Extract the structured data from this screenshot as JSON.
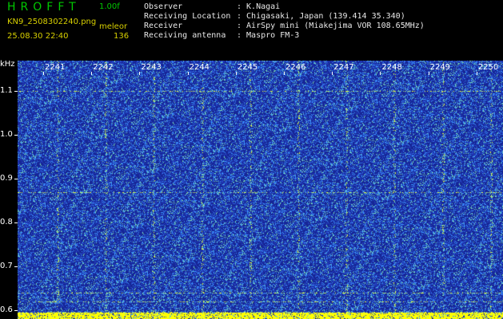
{
  "header": {
    "app_title": "HROFFT",
    "version": "1.00f",
    "filename": "KN9_2508302240.png",
    "mode": "meleor",
    "datetime": "25.08.30 22:40",
    "count": "136",
    "meta": [
      {
        "label": "Observer",
        "value": ": K.Nagai"
      },
      {
        "label": "Receiving Location",
        "value": ": Chigasaki, Japan (139.414 35.340)"
      },
      {
        "label": "Receiver",
        "value": ": AirSpy mini (Miakejima VOR 108.65MHz)"
      },
      {
        "label": "Receiving antenna",
        "value": ": Maspro FM-3"
      }
    ]
  },
  "chart_data": {
    "type": "heatmap",
    "ylabel": "kHz",
    "y_ticks": [
      "1.1",
      "1.0",
      "0.9",
      "0.8",
      "0.7",
      "0.6"
    ],
    "x_ticks": [
      "2241",
      "2242",
      "2243",
      "2244",
      "2245",
      "2246",
      "2247",
      "2248",
      "2249",
      "2250"
    ],
    "ylim": [
      0.58,
      1.17
    ],
    "horizontal_lines_khz": [
      1.1,
      0.87,
      0.64,
      0.62
    ],
    "colors": {
      "background": "#1a2aa0",
      "noise": "#3fa0ff",
      "hot": "#e8ff40",
      "floor": "#ffff00"
    }
  }
}
